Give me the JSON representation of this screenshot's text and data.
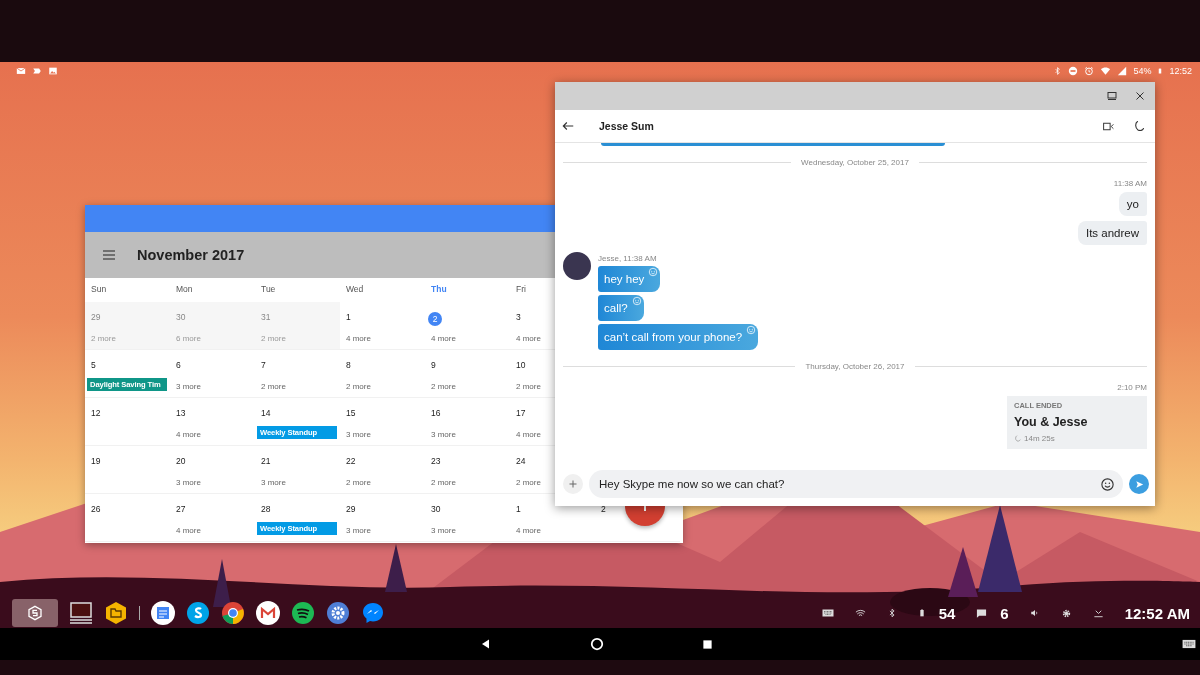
{
  "status_bar": {
    "battery": "54%",
    "time": "12:52"
  },
  "calendar": {
    "title": "November 2017",
    "weekdays": [
      {
        "label": "Sun",
        "today": false
      },
      {
        "label": "Mon",
        "today": false
      },
      {
        "label": "Tue",
        "today": false
      },
      {
        "label": "Wed",
        "today": false
      },
      {
        "label": "Thu",
        "today": true
      },
      {
        "label": "Fri",
        "today": false
      }
    ],
    "weeks": [
      {
        "days": [
          {
            "date": "29",
            "outside": true,
            "today": false,
            "more": "2 more"
          },
          {
            "date": "30",
            "outside": true,
            "today": false,
            "more": "6 more"
          },
          {
            "date": "31",
            "outside": true,
            "today": false,
            "more": "2 more"
          },
          {
            "date": "1",
            "outside": false,
            "today": false,
            "more": "4 more"
          },
          {
            "date": "2",
            "outside": false,
            "today": true,
            "more": "4 more"
          },
          {
            "date": "3",
            "outside": false,
            "today": false,
            "more": "4 more"
          }
        ]
      },
      {
        "days": [
          {
            "date": "5",
            "outside": false,
            "today": false,
            "event": {
              "title": "Daylight Saving Tim",
              "color": "#0f9688"
            }
          },
          {
            "date": "6",
            "outside": false,
            "today": false,
            "more": "3 more"
          },
          {
            "date": "7",
            "outside": false,
            "today": false,
            "more": "2 more"
          },
          {
            "date": "8",
            "outside": false,
            "today": false,
            "more": "2 more"
          },
          {
            "date": "9",
            "outside": false,
            "today": false,
            "more": "2 more"
          },
          {
            "date": "10",
            "outside": false,
            "today": false,
            "more": "2 more"
          }
        ]
      },
      {
        "days": [
          {
            "date": "12",
            "outside": false,
            "today": false
          },
          {
            "date": "13",
            "outside": false,
            "today": false,
            "more": "4 more"
          },
          {
            "date": "14",
            "outside": false,
            "today": false,
            "event": {
              "title": "Weekly Standup",
              "color": "#039be5"
            }
          },
          {
            "date": "15",
            "outside": false,
            "today": false,
            "more": "3 more"
          },
          {
            "date": "16",
            "outside": false,
            "today": false,
            "more": "3 more"
          },
          {
            "date": "17",
            "outside": false,
            "today": false,
            "more": "4 more"
          }
        ]
      },
      {
        "days": [
          {
            "date": "19",
            "outside": false,
            "today": false
          },
          {
            "date": "20",
            "outside": false,
            "today": false,
            "more": "3 more"
          },
          {
            "date": "21",
            "outside": false,
            "today": false,
            "more": "3 more"
          },
          {
            "date": "22",
            "outside": false,
            "today": false,
            "more": "2 more"
          },
          {
            "date": "23",
            "outside": false,
            "today": false,
            "more": "2 more"
          },
          {
            "date": "24",
            "outside": false,
            "today": false,
            "more": "2 more"
          }
        ]
      },
      {
        "days": [
          {
            "date": "26",
            "outside": false,
            "today": false
          },
          {
            "date": "27",
            "outside": false,
            "today": false,
            "more": "4 more"
          },
          {
            "date": "28",
            "outside": false,
            "today": false,
            "event": {
              "title": "Weekly Standup",
              "color": "#039be5"
            }
          },
          {
            "date": "29",
            "outside": false,
            "today": false,
            "more": "3 more"
          },
          {
            "date": "30",
            "outside": false,
            "today": false,
            "more": "3 more"
          },
          {
            "date": "1",
            "outside": false,
            "today": false,
            "more": "4 more"
          },
          {
            "date": "2",
            "outside": false,
            "today": false
          }
        ]
      }
    ]
  },
  "chat": {
    "contact": "Jesse Sum",
    "messages": [
      {
        "kind": "divider",
        "text": "Wednesday, October 25, 2017"
      },
      {
        "kind": "time",
        "text": "11:38 AM"
      },
      {
        "kind": "outgoing",
        "text": "yo"
      },
      {
        "kind": "outgoing",
        "text": "Its andrew"
      },
      {
        "kind": "incoming",
        "sender": "Jesse, 11:38 AM",
        "bubbles": [
          "hey hey",
          "call?",
          "can’t call from your phone?"
        ]
      },
      {
        "kind": "divider",
        "text": "Thursday, October 26, 2017"
      },
      {
        "kind": "time",
        "text": "2:10 PM"
      },
      {
        "kind": "call",
        "label": "CALL ENDED",
        "title": "You & Jesse",
        "duration": "14m 25s"
      }
    ],
    "composer": {
      "value": "Hey Skype me now so we can chat?"
    }
  },
  "taskbar": {
    "battery": "54",
    "notifications": "6",
    "time": "12:52 AM"
  }
}
